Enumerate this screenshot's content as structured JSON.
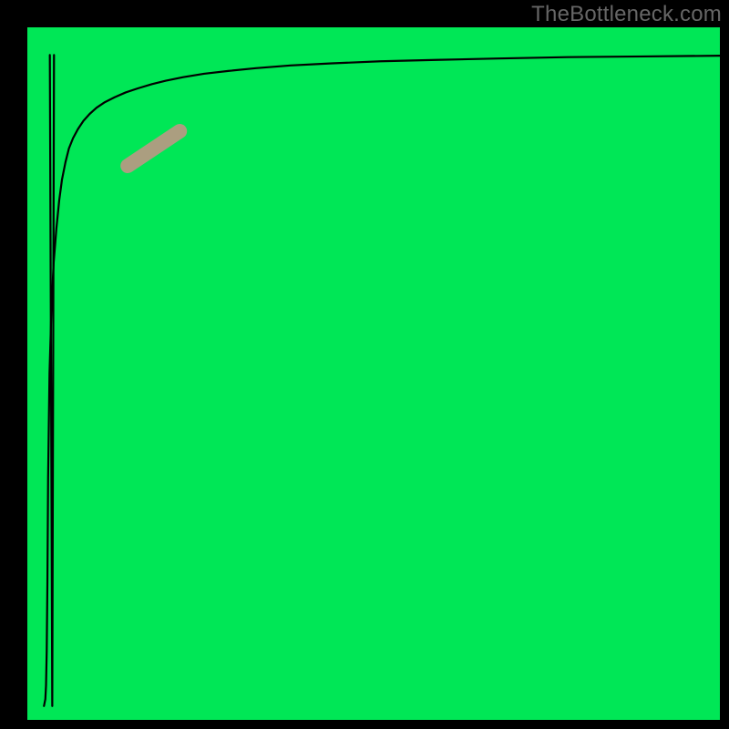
{
  "watermark": "TheBottleneck.com",
  "chart_data": {
    "type": "line",
    "title": "",
    "xlabel": "",
    "ylabel": "",
    "xlim": [
      0,
      100
    ],
    "ylim": [
      0,
      100
    ],
    "grid": false,
    "legend": false,
    "background_gradient": {
      "stops": [
        {
          "offset": 1.0,
          "color": "#00E756"
        },
        {
          "offset": 0.965,
          "color": "#00E756"
        },
        {
          "offset": 0.93,
          "color": "#F7FFA8"
        },
        {
          "offset": 0.85,
          "color": "#FFFA5E"
        },
        {
          "offset": 0.7,
          "color": "#FFE23C"
        },
        {
          "offset": 0.55,
          "color": "#FFBF2E"
        },
        {
          "offset": 0.4,
          "color": "#FF9725"
        },
        {
          "offset": 0.25,
          "color": "#FF6A2C"
        },
        {
          "offset": 0.1,
          "color": "#FF3A42"
        },
        {
          "offset": 0.0,
          "color": "#FF1E4C"
        }
      ]
    },
    "series": [
      {
        "name": "bottleneck-curve",
        "color": "#000000",
        "width": 2.2,
        "x": [
          2.4,
          2.6,
          2.7,
          2.8,
          2.9,
          3.0,
          3.2,
          3.5,
          3.8,
          4.2,
          4.6,
          5.0,
          5.5,
          6.0,
          6.6,
          7.3,
          8.1,
          9.0,
          10.0,
          11.2,
          12.6,
          14.2,
          16.0,
          18.0,
          20.0,
          22.5,
          25.5,
          29.0,
          33.0,
          38.0,
          44.0,
          51.0,
          59.0,
          68.0,
          78.0,
          89.0,
          100.0
        ],
        "y": [
          2.0,
          3.0,
          5.0,
          10.0,
          20.0,
          35.0,
          50.0,
          60.0,
          66.0,
          71.0,
          75.0,
          78.0,
          80.5,
          82.5,
          84.0,
          85.3,
          86.5,
          87.5,
          88.4,
          89.2,
          89.9,
          90.6,
          91.2,
          91.8,
          92.3,
          92.8,
          93.3,
          93.7,
          94.1,
          94.5,
          94.8,
          95.1,
          95.3,
          95.5,
          95.7,
          95.8,
          95.9
        ]
      },
      {
        "name": "spike-down",
        "color": "#000000",
        "width": 2.2,
        "x": [
          3.25,
          3.6,
          3.85
        ],
        "y": [
          96.0,
          2.0,
          96.0
        ]
      }
    ],
    "highlight": {
      "name": "highlight-segment",
      "color": "#C99187",
      "opacity": 0.85,
      "width": 16,
      "x_start": 14.5,
      "y_start": 80.0,
      "x_end": 22.0,
      "y_end": 85.0
    }
  }
}
